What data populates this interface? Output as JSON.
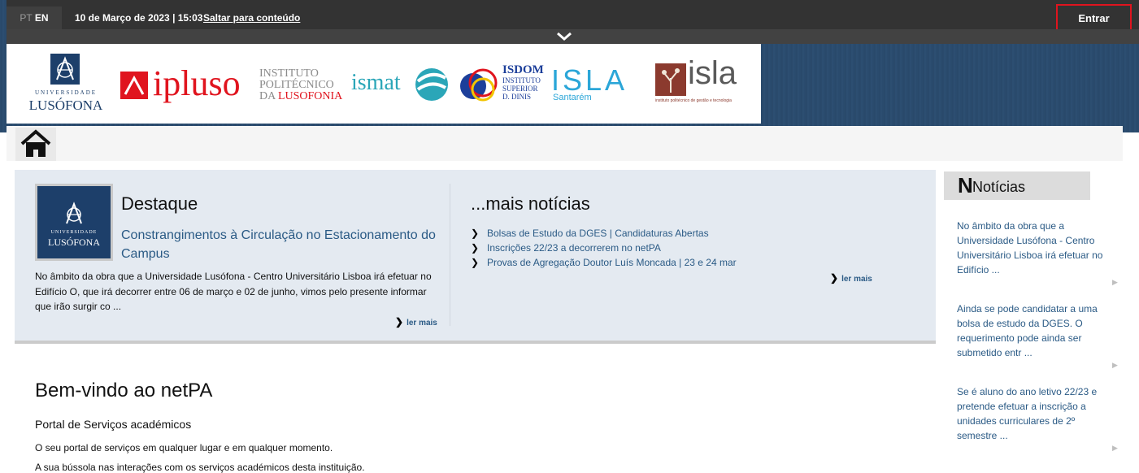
{
  "header": {
    "lang_pt": "PT",
    "lang_en": "EN",
    "datetime": "10 de Março de 2023 | 15:03",
    "skip_link": "Saltar para conteúdo",
    "login": "Entrar"
  },
  "logos": {
    "ul_small": "UNIVERSIDADE",
    "ul_big": "LUSÓFONA",
    "ipluso": "ipluso",
    "ipl_line1": "INSTITUTO",
    "ipl_line2": "POLITÉCNICO",
    "ipl_line3a": "DA ",
    "ipl_line3b": "LUSOFONIA",
    "ismat": "ismat",
    "isdom_line1": "ISDOM",
    "isdom_line2": "INSTITUTO",
    "isdom_line3": "SUPERIOR",
    "isdom_line4": "D. DINIS",
    "isla_santarem": "ISLA",
    "santarem": "Santarém",
    "isla": "isla",
    "isla_sub": "instituto politécnico de gestão e tecnologia"
  },
  "featured": {
    "title": "Destaque",
    "thumb_small": "UNIVERSIDADE",
    "thumb_big": "LUSÓFONA",
    "link": "Constrangimentos à Circulação no Estacionamento do Campus",
    "text": "No âmbito da obra que a Universidade Lusófona - Centro Universitário Lisboa irá efetuar no Edifício O, que irá decorrer entre 06 de março e 02 de junho, vimos pelo presente informar que irão surgir co ...",
    "more": "ler mais"
  },
  "more_news": {
    "title": "...mais notícias",
    "items": [
      "Bolsas de Estudo da DGES | Candidaturas Abertas",
      "Inscrições 22/23 a decorrerem no netPA",
      "Provas de Agregação Doutor Luís Moncada | 23 e 24 mar"
    ],
    "more": "ler mais"
  },
  "sidebar": {
    "title_initial": "N",
    "title_rest": "Notícias",
    "items": [
      "No âmbito da obra que a Universidade Lusófona - Centro Universitário Lisboa irá efetuar no Edifício ...",
      "Ainda se pode candidatar a uma bolsa de estudo da DGES. O requerimento pode ainda ser submetido entr ...",
      "Se é aluno do ano letivo 22/23 e pretende efetuar a inscrição a unidades curriculares de 2º semestre ..."
    ]
  },
  "welcome": {
    "title": "Bem-vindo ao netPA",
    "subtitle": "Portal de Serviços académicos",
    "text": "O seu portal de serviços em qualquer lugar e em qualquer momento.",
    "cut_text": "A sua bússola nas interações com os serviços académicos desta instituição."
  },
  "colors": {
    "accent_red": "#e0141e",
    "link_blue": "#2a5a85",
    "banner_blue": "#2b4c6e"
  }
}
